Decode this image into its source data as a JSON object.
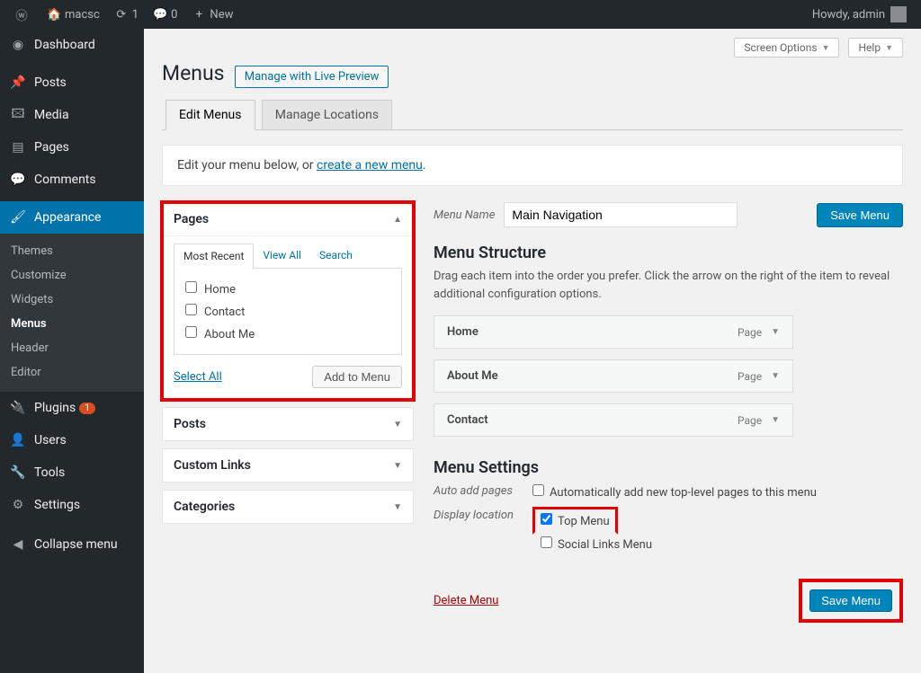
{
  "adminbar": {
    "site_name": "macsc",
    "updates": "1",
    "comments": "0",
    "new_label": "New",
    "howdy": "Howdy, admin"
  },
  "sidebar": {
    "items": [
      {
        "label": "Dashboard",
        "icon": "dashboard"
      },
      {
        "label": "Posts",
        "icon": "pin"
      },
      {
        "label": "Media",
        "icon": "media"
      },
      {
        "label": "Pages",
        "icon": "page"
      },
      {
        "label": "Comments",
        "icon": "comment"
      },
      {
        "label": "Appearance",
        "icon": "appearance",
        "current": true
      },
      {
        "label": "Plugins",
        "icon": "plugin",
        "badge": "1"
      },
      {
        "label": "Users",
        "icon": "user"
      },
      {
        "label": "Tools",
        "icon": "tool"
      },
      {
        "label": "Settings",
        "icon": "settings"
      }
    ],
    "appearance_sub": [
      "Themes",
      "Customize",
      "Widgets",
      "Menus",
      "Header",
      "Editor"
    ],
    "appearance_current": "Menus",
    "collapse": "Collapse menu"
  },
  "header": {
    "screen_options": "Screen Options",
    "help": "Help",
    "title": "Menus",
    "live_preview": "Manage with Live Preview"
  },
  "tabs": {
    "edit": "Edit Menus",
    "locations": "Manage Locations"
  },
  "manage_text_pre": "Edit your menu below, or ",
  "manage_link": "create a new menu",
  "manage_text_post": ".",
  "metabox": {
    "pages": {
      "title": "Pages",
      "tabs": {
        "recent": "Most Recent",
        "all": "View All",
        "search": "Search"
      },
      "items": [
        "Home",
        "Contact",
        "About Me"
      ],
      "select_all": "Select All",
      "add": "Add to Menu"
    },
    "posts": "Posts",
    "custom": "Custom Links",
    "categories": "Categories"
  },
  "menu_name_label": "Menu Name",
  "menu_name_value": "Main Navigation",
  "save_menu": "Save Menu",
  "structure_h": "Menu Structure",
  "structure_desc": "Drag each item into the order you prefer. Click the arrow on the right of the item to reveal additional configuration options.",
  "menu_items": [
    {
      "title": "Home",
      "type": "Page"
    },
    {
      "title": "About Me",
      "type": "Page"
    },
    {
      "title": "Contact",
      "type": "Page"
    }
  ],
  "settings_h": "Menu Settings",
  "settings": {
    "auto_label": "Auto add pages",
    "auto_opt": "Automatically add new top-level pages to this menu",
    "loc_label": "Display location",
    "loc1": "Top Menu",
    "loc2": "Social Links Menu"
  },
  "delete_menu": "Delete Menu"
}
